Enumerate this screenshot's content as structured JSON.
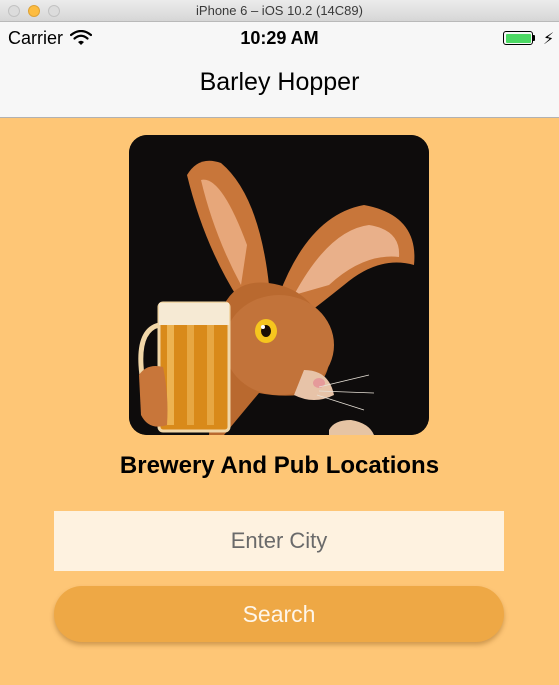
{
  "window": {
    "title": "iPhone 6 – iOS 10.2 (14C89)"
  },
  "status_bar": {
    "carrier": "Carrier",
    "time": "10:29 AM"
  },
  "nav": {
    "title": "Barley Hopper"
  },
  "main": {
    "heading": "Brewery And Pub Locations",
    "city_input": {
      "value": "",
      "placeholder": "Enter City"
    },
    "search_label": "Search"
  },
  "colors": {
    "background": "#fec676",
    "button": "#eea845",
    "input": "#fef2e0",
    "battery": "#4cd964"
  },
  "icons": [
    "wifi-icon",
    "battery-icon",
    "charging-bolt-icon",
    "rabbit-with-beer-image"
  ]
}
